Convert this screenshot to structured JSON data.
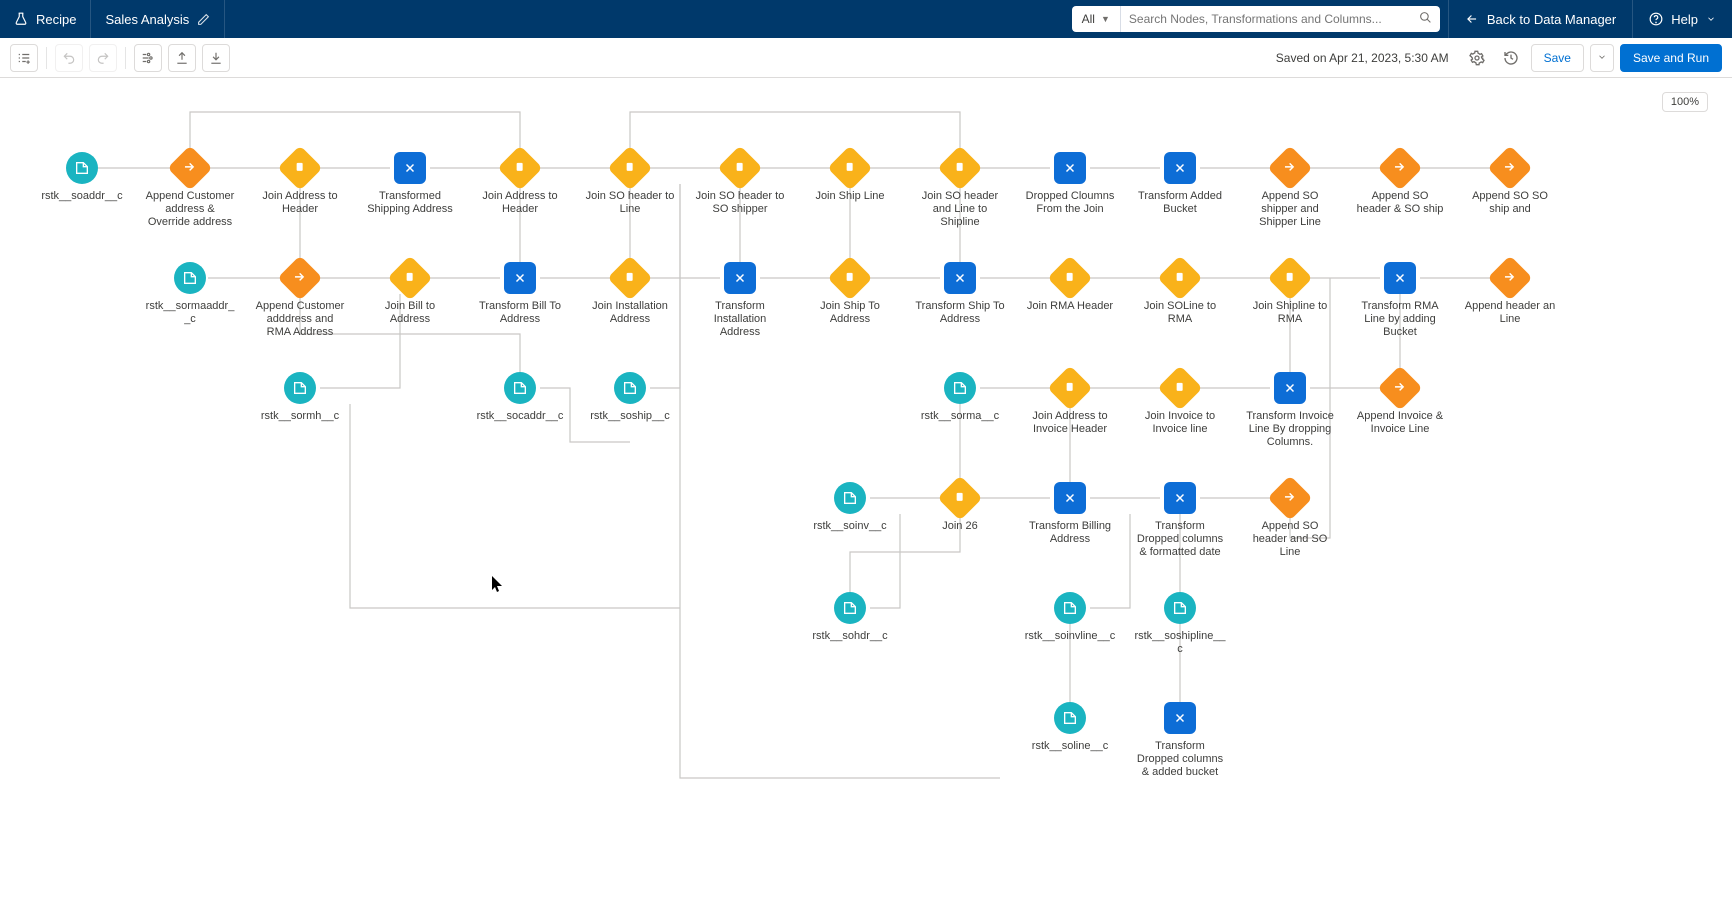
{
  "header": {
    "recipe_tab": "Recipe",
    "title": "Sales Analysis",
    "search_scope": "All",
    "search_placeholder": "Search Nodes, Transformations and Columns...",
    "back": "Back to Data Manager",
    "help": "Help"
  },
  "toolbar": {
    "saved": "Saved on Apr 21, 2023, 5:30 AM",
    "save": "Save",
    "run": "Save and Run"
  },
  "canvas": {
    "zoom": "100%"
  },
  "nodes": {
    "n_soaddr": {
      "label": "rstk__soaddr__c"
    },
    "n_appendCust": {
      "label": "Append Customer address & Override address"
    },
    "n_joinAddrHdr": {
      "label": "Join Address to Header"
    },
    "n_xformShip": {
      "label": "Transformed Shipping Address"
    },
    "n_joinAddrHdr2": {
      "label": "Join Address to Header"
    },
    "n_joinSOhdrLine": {
      "label": "Join SO header to Line"
    },
    "n_joinSOhdrShip": {
      "label": "Join SO header to SO shipper"
    },
    "n_joinShipLine": {
      "label": "Join Ship Line"
    },
    "n_joinSOhdrShp2": {
      "label": "Join SO header and Line to Shipline"
    },
    "n_dropCols": {
      "label": "Dropped Cloumns From the Join"
    },
    "n_xformAdded": {
      "label": "Transform Added Bucket"
    },
    "n_appendShipper": {
      "label": "Append SO shipper and Shipper Line"
    },
    "n_appendSOhdr": {
      "label": "Append SO header & SO ship"
    },
    "n_appendSOship": {
      "label": "Append SO SO ship and"
    },
    "n_sormaaddr": {
      "label": "rstk__sormaaddr__c"
    },
    "n_appendCustRMA": {
      "label": "Append Customer adddress and RMA Address"
    },
    "n_joinBillAddr": {
      "label": "Join Bill to Address"
    },
    "n_xformBill": {
      "label": "Transform Bill To Address"
    },
    "n_joinInstAddr": {
      "label": "Join Installation Address"
    },
    "n_xformInstAddr": {
      "label": "Transform Installation Address"
    },
    "n_joinShipTo": {
      "label": "Join Ship To Address"
    },
    "n_xformShipTo": {
      "label": "Transform Ship To Address"
    },
    "n_joinRMAhdr": {
      "label": "Join RMA Header"
    },
    "n_joinSOlineRMA": {
      "label": "Join SOLine to RMA"
    },
    "n_joinShiplineRMA": {
      "label": "Join Shipline to RMA"
    },
    "n_xformRMAline": {
      "label": "Transform RMA Line by adding Bucket"
    },
    "n_appendHdrLine": {
      "label": "Append header an Line"
    },
    "n_sormh": {
      "label": "rstk__sormh__c"
    },
    "n_socaddr": {
      "label": "rstk__socaddr__c"
    },
    "n_soship": {
      "label": "rstk__soship__c"
    },
    "n_sorma": {
      "label": "rstk__sorma__c"
    },
    "n_joinAddrInvHdr": {
      "label": "Join Address to Invoice Header"
    },
    "n_joinInvInvLine": {
      "label": "Join Invoice to Invoice line"
    },
    "n_xformInvDrop": {
      "label": "Transform Invoice Line By dropping Columns."
    },
    "n_appendInvLine": {
      "label": "Append Invoice & Invoice Line"
    },
    "n_soinv": {
      "label": "rstk__soinv__c"
    },
    "n_join26": {
      "label": "Join 26"
    },
    "n_xformBilling": {
      "label": "Transform Billing Address"
    },
    "n_xformDropDate": {
      "label": "Transform Dropped columns & formatted date"
    },
    "n_appendSOhdrLine": {
      "label": "Append SO header and SO Line"
    },
    "n_sohdr": {
      "label": "rstk__sohdr__c"
    },
    "n_soinvline": {
      "label": "rstk__soinvline__c"
    },
    "n_soshipline": {
      "label": "rstk__soshipline__c"
    },
    "n_soline": {
      "label": "rstk__soline__c"
    },
    "n_xformDropBucket": {
      "label": "Transform Dropped columns & added bucket"
    }
  }
}
